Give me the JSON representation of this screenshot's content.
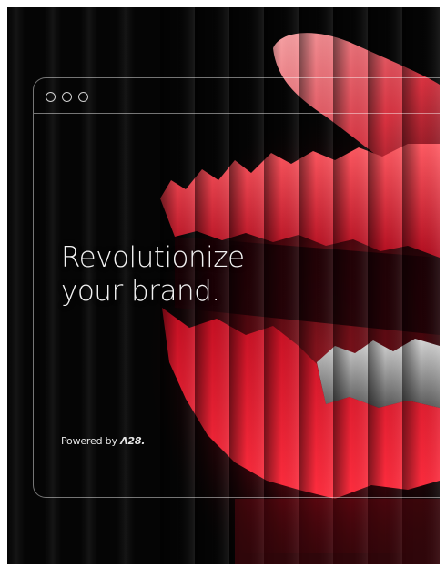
{
  "headline": {
    "line1": "Revolutionize",
    "line2": "your brand."
  },
  "footer": {
    "powered_text": "Powered by",
    "brand": "Λ28."
  },
  "window_controls": [
    "dot",
    "dot",
    "dot"
  ],
  "colors": {
    "background": "#050505",
    "accent_red": "#e8142b",
    "frame_line": "#bfbfbf",
    "text": "#f2f2f2"
  }
}
